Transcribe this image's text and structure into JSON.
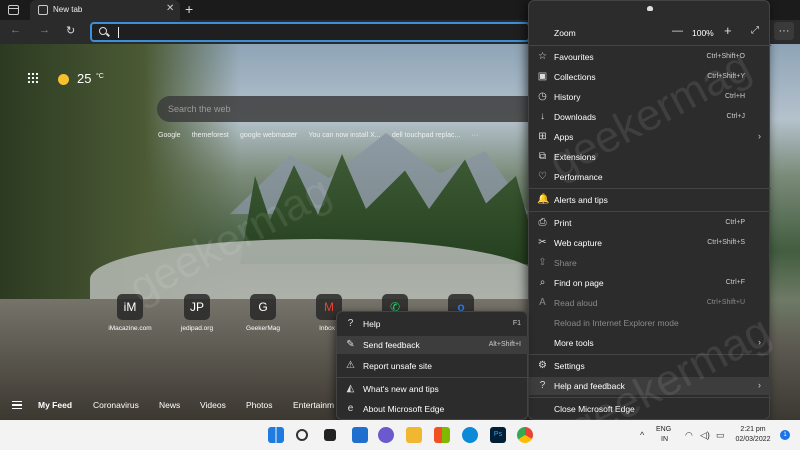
{
  "browser": {
    "tab_title": "New tab",
    "tab_close": "✕",
    "new_tab": "+",
    "nav": {
      "back": "←",
      "forward": "→",
      "refresh": "↻"
    },
    "address_value": "",
    "toolbar_right": {
      "split": "⧉",
      "more": "···"
    }
  },
  "newtab": {
    "weather_temp": "25",
    "weather_unit": "°C",
    "search_placeholder": "Search the web",
    "quick_links": [
      "Google",
      "themeforest",
      "google webmaster",
      "You can now install X...",
      "dell touchpad replac...",
      "···"
    ],
    "tiles": [
      {
        "badge": "iM",
        "label": "iMacazine.com"
      },
      {
        "badge": "JP",
        "label": "jedipad.org"
      },
      {
        "badge": "G",
        "label": "GeekerMag"
      },
      {
        "badge": "M",
        "label": "Inbox ("
      },
      {
        "badge": "✆",
        "label": ""
      },
      {
        "badge": "o",
        "label": ""
      }
    ],
    "feed": [
      "My Feed",
      "Coronavirus",
      "News",
      "Videos",
      "Photos",
      "Entertainm"
    ]
  },
  "menu": {
    "zoom_label": "Zoom",
    "zoom_minus": "—",
    "zoom_value": "100%",
    "zoom_plus": "+",
    "zoom_full": "⤢",
    "items": [
      {
        "icon": "☆",
        "label": "Favourites",
        "shortcut": "Ctrl+Shift+O"
      },
      {
        "icon": "▣",
        "label": "Collections",
        "shortcut": "Ctrl+Shift+Y"
      },
      {
        "icon": "◷",
        "label": "History",
        "shortcut": "Ctrl+H"
      },
      {
        "icon": "↓",
        "label": "Downloads",
        "shortcut": "Ctrl+J"
      },
      {
        "icon": "⊞",
        "label": "Apps",
        "shortcut": "",
        "arrow": "›"
      },
      {
        "icon": "⧉",
        "label": "Extensions",
        "shortcut": ""
      },
      {
        "icon": "♡",
        "label": "Performance",
        "shortcut": ""
      },
      {
        "icon": "🔔",
        "label": "Alerts and tips",
        "shortcut": ""
      },
      {
        "icon": "⎙",
        "label": "Print",
        "shortcut": "Ctrl+P"
      },
      {
        "icon": "✂",
        "label": "Web capture",
        "shortcut": "Ctrl+Shift+S"
      },
      {
        "icon": "⇪",
        "label": "Share",
        "shortcut": ""
      },
      {
        "icon": "⌕",
        "label": "Find on page",
        "shortcut": "Ctrl+F"
      },
      {
        "icon": "A",
        "label": "Read aloud",
        "shortcut": "Ctrl+Shift+U"
      },
      {
        "icon": "",
        "label": "Reload in Internet Explorer mode",
        "shortcut": ""
      },
      {
        "icon": "",
        "label": "More tools",
        "shortcut": "",
        "arrow": "›"
      },
      {
        "icon": "⚙",
        "label": "Settings",
        "shortcut": ""
      },
      {
        "icon": "?",
        "label": "Help and feedback",
        "shortcut": "",
        "arrow": "›"
      },
      {
        "icon": "",
        "label": "Close Microsoft Edge",
        "shortcut": ""
      }
    ]
  },
  "submenu": {
    "items": [
      {
        "icon": "?",
        "label": "Help",
        "shortcut": "F1"
      },
      {
        "icon": "✎",
        "label": "Send feedback",
        "shortcut": "Alt+Shift+I"
      },
      {
        "icon": "⚠",
        "label": "Report unsafe site",
        "shortcut": ""
      },
      {
        "icon": "◭",
        "label": "What's new and tips",
        "shortcut": ""
      },
      {
        "icon": "e",
        "label": "About Microsoft Edge",
        "shortcut": ""
      }
    ]
  },
  "watermark": "geekermag",
  "taskbar": {
    "lang_top": "ENG",
    "lang_bottom": "IN",
    "time": "2:21 pm",
    "date": "02/03/2022",
    "notif_count": "1",
    "chevron": "^",
    "tray_icons": [
      "wifi-icon",
      "volume-icon",
      "battery-icon"
    ],
    "app_icons": [
      "windows-start-icon",
      "search-icon",
      "task-view-icon",
      "widgets-icon",
      "teams-chat-icon",
      "file-explorer-icon",
      "store-icon",
      "edge-icon",
      "photoshop-icon",
      "chrome-icon"
    ]
  }
}
